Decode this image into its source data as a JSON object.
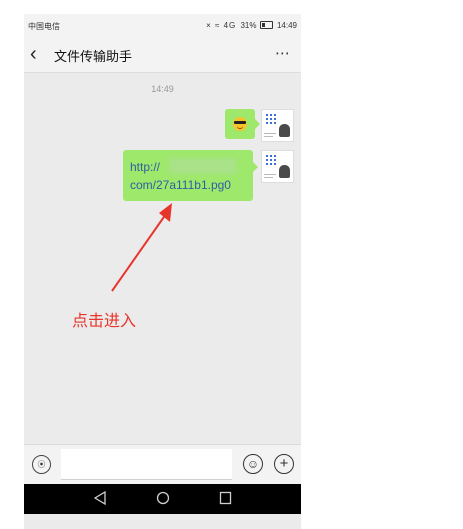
{
  "status_bar": {
    "carrier": "中国电信",
    "icons": "× ≈ 4G",
    "battery": "31%",
    "time": "14:49"
  },
  "header": {
    "back_icon": "chevron-left-icon",
    "title": "文件传输助手",
    "more_icon": "more-icon"
  },
  "chat": {
    "timestamp": "14:49",
    "messages": [
      {
        "type": "emoji",
        "icon": "cool-face-emoji"
      },
      {
        "type": "link",
        "line1": "http://",
        "line2": "com/27a111b1.pg0"
      }
    ]
  },
  "annotation": {
    "text": "点击进入",
    "color": "#e8352b"
  },
  "input_bar": {
    "voice_icon": "voice-icon",
    "emoji_icon": "emoji-icon",
    "plus_icon": "plus-icon"
  },
  "nav_bar": {
    "back_icon": "nav-back-icon",
    "home_icon": "nav-home-icon",
    "recent_icon": "nav-recent-icon"
  },
  "colors": {
    "bubble_green": "#9ee86b",
    "link_blue": "#2d5fa3",
    "chat_bg": "#ebebeb"
  }
}
